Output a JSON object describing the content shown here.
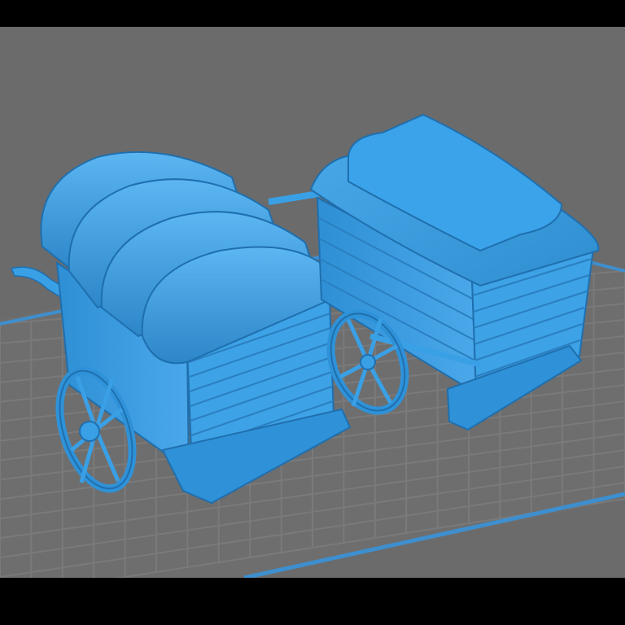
{
  "app": {
    "type": "slicer-3d-viewport"
  },
  "scene": {
    "background_color": "#6b6b6b",
    "build_plate": {
      "grid_color": "#7a7a7a",
      "border_color": "#3d8fcf"
    },
    "model_color": "#3aa0e6",
    "models": [
      {
        "id": "covered-wagon-rounded-canopy"
      },
      {
        "id": "covered-wagon-flat-roof"
      }
    ]
  }
}
